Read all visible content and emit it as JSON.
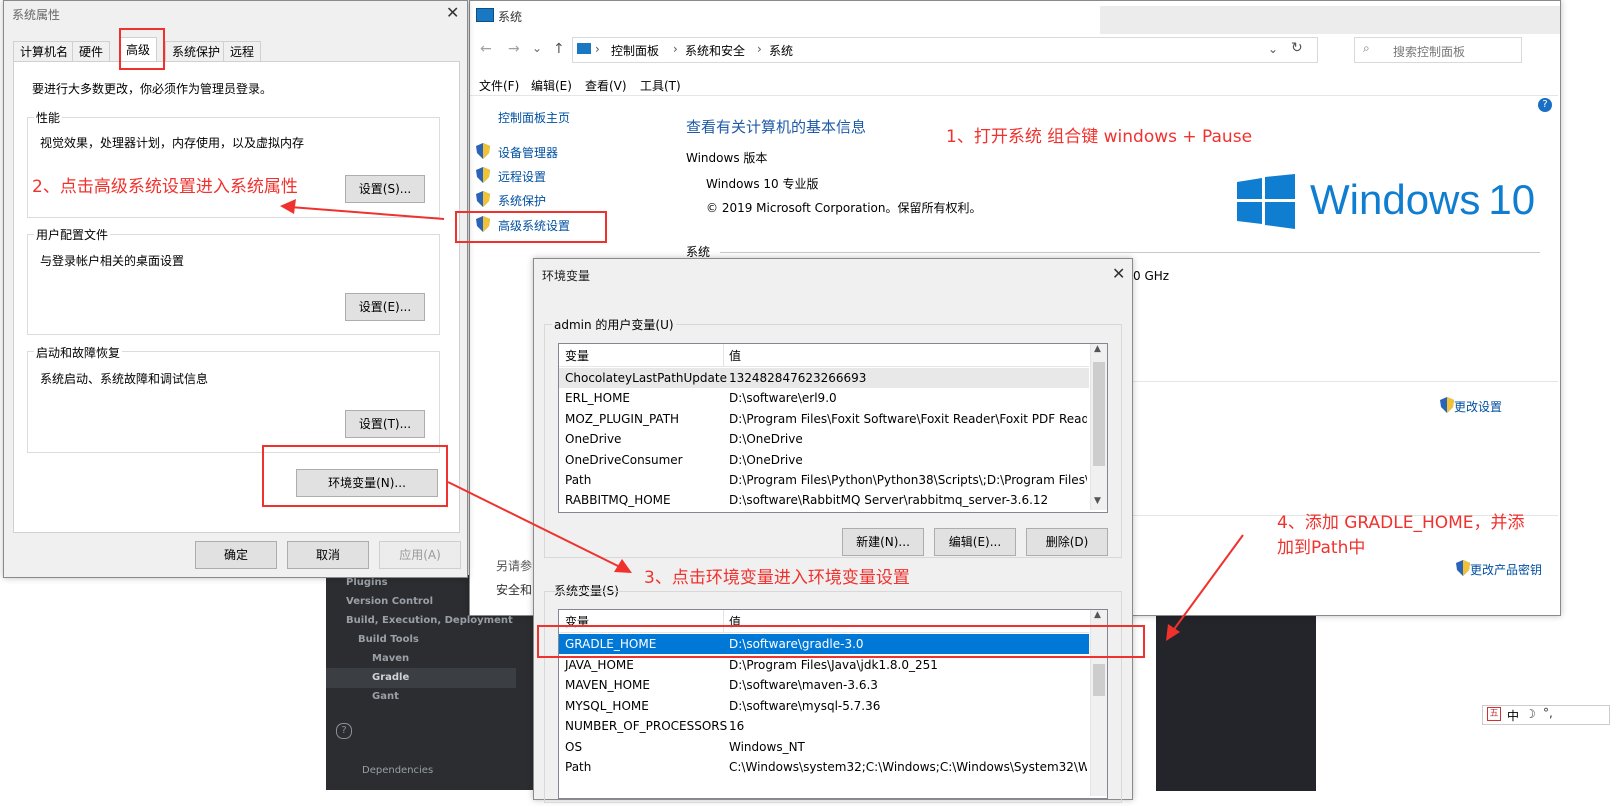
{
  "sysprops": {
    "title": "系统属性",
    "tabs": [
      "计算机名",
      "硬件",
      "高级",
      "系统保护",
      "远程"
    ],
    "admin_note": "要进行大多数更改，你必须作为管理员登录。",
    "perf": {
      "label": "性能",
      "desc": "视觉效果，处理器计划，内存使用，以及虚拟内存",
      "button": "设置(S)..."
    },
    "profile": {
      "label": "用户配置文件",
      "desc": "与登录帐户相关的桌面设置",
      "button": "设置(E)..."
    },
    "startup": {
      "label": "启动和故障恢复",
      "desc": "系统启动、系统故障和调试信息",
      "button": "设置(T)..."
    },
    "env_button": "环境变量(N)...",
    "ok": "确定",
    "cancel": "取消",
    "apply": "应用(A)"
  },
  "system": {
    "title": "系统",
    "breadcrumb": [
      "控制面板",
      "系统和安全",
      "系统"
    ],
    "search_placeholder": "搜索控制面板",
    "menu": [
      "文件(F)",
      "编辑(E)",
      "查看(V)",
      "工具(T)"
    ],
    "left_home": "控制面板主页",
    "left_links": [
      "设备管理器",
      "远程设置",
      "系统保护",
      "高级系统设置"
    ],
    "heading": "查看有关计算机的基本信息",
    "edition_label": "Windows 版本",
    "edition": "Windows 10 专业版",
    "copyright": "© 2019 Microsoft Corporation。保留所有权利。",
    "system_label": "系统",
    "cpu_tail": "0 GHz",
    "logo_text": "Windows",
    "logo_num": "10",
    "change_settings": "更改设置",
    "change_key": "更改产品密钥",
    "see_also_1": "另请参",
    "see_also_2": "安全和"
  },
  "envvars": {
    "title": "环境变量",
    "user_label": "admin 的用户变量(U)",
    "col_var": "变量",
    "col_val": "值",
    "user_rows": [
      {
        "name": "ChocolateyLastPathUpdate",
        "value": "132482847623266693"
      },
      {
        "name": "ERL_HOME",
        "value": "D:\\software\\erl9.0"
      },
      {
        "name": "MOZ_PLUGIN_PATH",
        "value": "D:\\Program Files\\Foxit Software\\Foxit Reader\\Foxit PDF Read..."
      },
      {
        "name": "OneDrive",
        "value": "D:\\OneDrive"
      },
      {
        "name": "OneDriveConsumer",
        "value": "D:\\OneDrive"
      },
      {
        "name": "Path",
        "value": "D:\\Program Files\\Python\\Python38\\Scripts\\;D:\\Program Files\\..."
      },
      {
        "name": "RABBITMQ_HOME",
        "value": "D:\\software\\RabbitMQ Server\\rabbitmq_server-3.6.12"
      }
    ],
    "new_btn": "新建(N)...",
    "edit_btn": "编辑(E)...",
    "del_btn": "删除(D)",
    "sys_label": "系统变量(S)",
    "sys_rows": [
      {
        "name": "GRADLE_HOME",
        "value": "D:\\software\\gradle-3.0"
      },
      {
        "name": "JAVA_HOME",
        "value": "D:\\Program Files\\Java\\jdk1.8.0_251"
      },
      {
        "name": "MAVEN_HOME",
        "value": "D:\\software\\maven-3.6.3"
      },
      {
        "name": "MYSQL_HOME",
        "value": "D:\\software\\mysql-5.7.36"
      },
      {
        "name": "NUMBER_OF_PROCESSORS",
        "value": "16"
      },
      {
        "name": "OS",
        "value": "Windows_NT"
      },
      {
        "name": "Path",
        "value": "C:\\Windows\\system32;C:\\Windows;C:\\Windows\\System32\\Wb..."
      }
    ]
  },
  "ide": {
    "items": [
      "Plugins",
      "Version Control",
      "Build, Execution, Deployment",
      "Build Tools",
      "Maven",
      "Gradle",
      "Gant"
    ],
    "dependencies": "Dependencies"
  },
  "annotations": {
    "a1": "1、打开系统 组合键 windows + Pause",
    "a2": "2、点击高级系统设置进入系统属性",
    "a3": "3、点击环境变量进入环境变量设置",
    "a4_line1": "4、添加 GRADLE_HOME，并添",
    "a4_line2": "加到Path中"
  },
  "ime": {
    "text": "中"
  },
  "colors": {
    "accent": "#0078d7",
    "annotation": "#f0322e",
    "link": "#0050a0"
  }
}
